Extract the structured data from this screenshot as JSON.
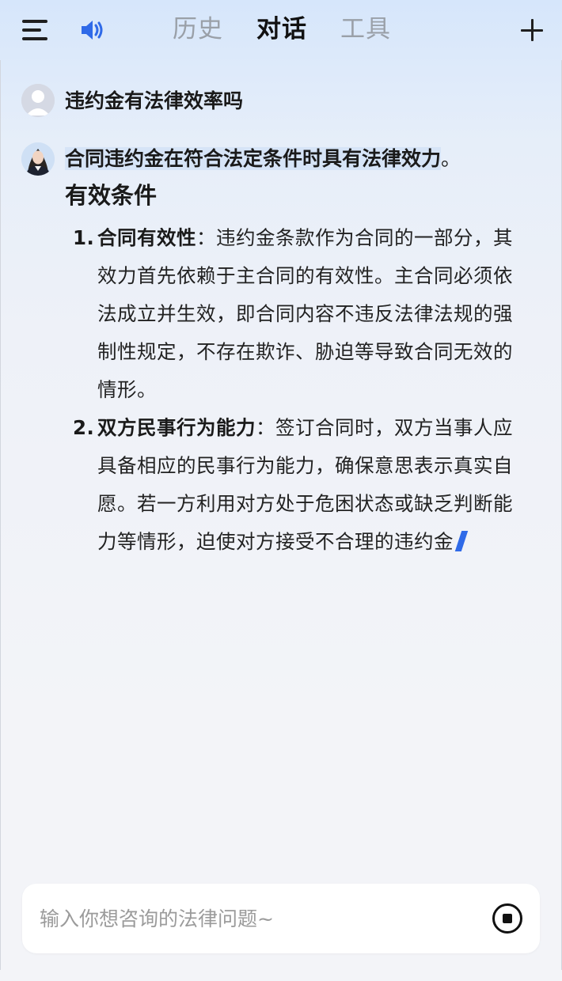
{
  "header": {
    "menu_icon": "menu-icon",
    "speaker_icon": "speaker-icon",
    "tabs": [
      {
        "label": "历史",
        "active": false
      },
      {
        "label": "对话",
        "active": true
      },
      {
        "label": "工具",
        "active": false
      }
    ],
    "plus_icon": "plus-icon",
    "accent_color": "#2f6ae8"
  },
  "conversation": {
    "user_question": "违约金有法律效率吗",
    "answer": {
      "lead_highlight": "合同违约金在符合法定条件时具有法律效力",
      "lead_end": "。",
      "section_title": "有效条件",
      "items": [
        {
          "number": "1.",
          "term": "合同有效性",
          "text": "：违约金条款作为合同的一部分，其效力首先依赖于主合同的有效性。主合同必须依法成立并生效，即合同内容不违反法律法规的强制性规定，不存在欺诈、胁迫等导致合同无效的情形。"
        },
        {
          "number": "2.",
          "term": "双方民事行为能力",
          "text": "：签订合同时，双方当事人应具备相应的民事行为能力，确保意思表示真实自愿。若一方利用对方处于危困状态或缺乏判断能力等情形，迫使对方接受不合理的违约金"
        }
      ]
    }
  },
  "input": {
    "placeholder": "输入你想咨询的法律问题~",
    "value": "",
    "stop_icon": "stop-icon"
  }
}
